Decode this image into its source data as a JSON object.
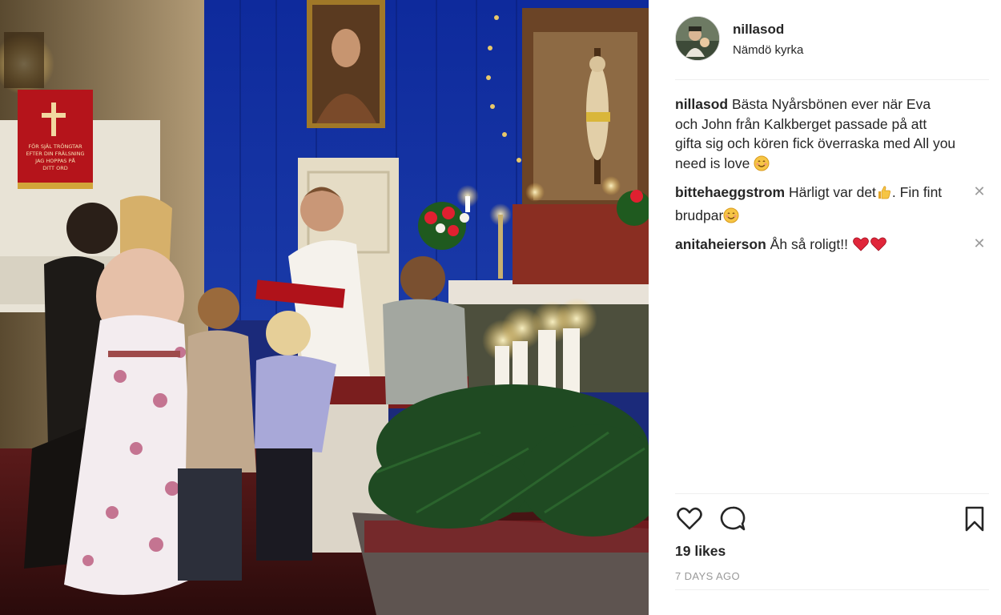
{
  "post": {
    "username": "nillasod",
    "location": "Nämdö kyrka"
  },
  "comments": [
    {
      "user": "nillasod",
      "text": "Bästa Nyårsbönen ever när Eva och John från Kalkberget passade på att gifta sig och kören fick överraska med All you need is love",
      "emoji": "smiling-face-icon"
    },
    {
      "user": "bittehaeggstrom",
      "text_a": "Härligt var det",
      "emoji_a": "thumbs-up-icon",
      "text_b": ". Fin fint brudpar",
      "emoji_b": "smiling-face-icon"
    },
    {
      "user": "anitaheierson",
      "text": "Åh så roligt!!",
      "emoji": "red-heart-icon"
    }
  ],
  "likes": "19 likes",
  "timestamp": "7 DAYS AGO",
  "banner_text": [
    "FÖR SJÄL TRÖNGTAR",
    "EFTER DIN FRÄLSNING",
    "JAG HOPPAS PÅ",
    "DITT ORD"
  ],
  "icons": {
    "like": "heart-icon",
    "comment": "speech-bubble-icon",
    "save": "bookmark-icon",
    "remove": "close-icon"
  },
  "colors": {
    "text": "#262626",
    "muted": "#999999",
    "divider": "#efefef",
    "heart": "#e0263a",
    "wall_blue": "#1b2f96"
  }
}
